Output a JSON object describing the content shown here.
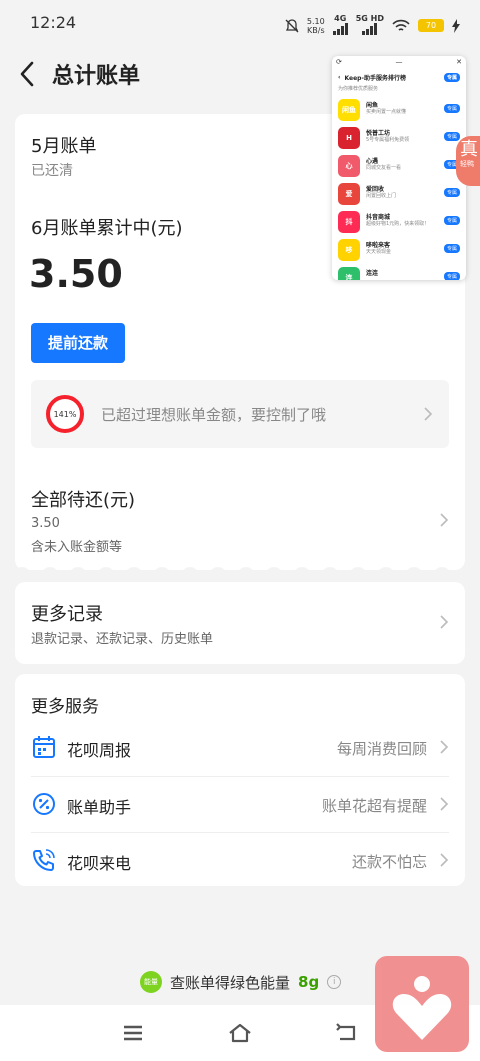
{
  "status_bar": {
    "time": "12:24",
    "speed_value": "5.10",
    "speed_unit": "KB/s",
    "network1": "4G",
    "network2": "5G HD",
    "battery": "70"
  },
  "header": {
    "title": "总计账单"
  },
  "bill_card": {
    "may_title": "5月账单",
    "may_status": "已还清",
    "june_title": "6月账单累计中(元)",
    "june_amount": "3.50",
    "repay_button": "提前还款",
    "tip_percent": "141%",
    "tip_percent_value": 1.41,
    "tip_text": "已超过理想账单金额，要控制了哦",
    "pending_title": "全部待还(元)",
    "pending_amount": "3.50",
    "pending_note": "含未入账金额等"
  },
  "records_card": {
    "title": "更多记录",
    "subtitle": "退款记录、还款记录、历史账单"
  },
  "services_card": {
    "title": "更多服务",
    "items": [
      {
        "label": "花呗周报",
        "right": "每周消费回顾",
        "icon": "calendar-icon"
      },
      {
        "label": "账单助手",
        "right": "账单花超有提醒",
        "icon": "percent-icon"
      },
      {
        "label": "花呗来电",
        "right": "还款不怕忘",
        "icon": "phone-icon"
      }
    ]
  },
  "energy": {
    "badge": "能量",
    "text": "查账单得绿色能量",
    "value": "8g",
    "info": "i"
  },
  "float_panel": {
    "title": "Keep-助手服务排行榜",
    "header_btn": "专属",
    "subheader": "为你推荐优质服务",
    "items": [
      {
        "name": "闲鱼",
        "logo": "闲鱼",
        "desc": "买卖闲置一点就懂",
        "btn": "专属",
        "color": "#ffde00"
      },
      {
        "name": "悦普工坊",
        "logo": "H",
        "desc": "5号专属福利免费领",
        "btn": "专属",
        "color": "#d9232e"
      },
      {
        "name": "心遇",
        "logo": "心",
        "desc": "同城交友看一看",
        "btn": "专属",
        "color": "#f05a6a"
      },
      {
        "name": "爱回收",
        "logo": "爱",
        "desc": "闲置回收上门",
        "btn": "专属",
        "color": "#e8453c"
      },
      {
        "name": "抖音商城",
        "logo": "抖",
        "desc": "超级好物1元购，快来领取！",
        "btn": "专属",
        "color": "#fe2c55"
      },
      {
        "name": "哆啦来客",
        "logo": "哆",
        "desc": "天天领现金",
        "btn": "专属",
        "color": "#ffd200"
      },
      {
        "name": "连连",
        "logo": "连",
        "desc": "",
        "btn": "专属",
        "color": "#2dbf6a"
      }
    ]
  },
  "side_badge": {
    "char": "真",
    "sub": "轻鸭"
  },
  "colors": {
    "accent": "#1677ff",
    "warning": "#f5222d",
    "energy": "#3aa000"
  }
}
